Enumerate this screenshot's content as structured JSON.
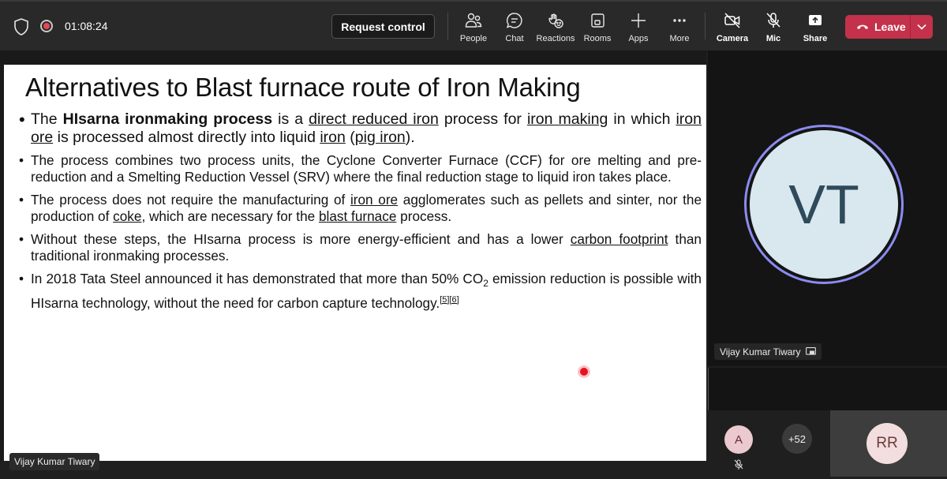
{
  "toolbar": {
    "timer": "01:08:24",
    "request_control": "Request control",
    "items": [
      {
        "label": "People",
        "icon": "people-icon"
      },
      {
        "label": "Chat",
        "icon": "chat-icon"
      },
      {
        "label": "Reactions",
        "icon": "reactions-icon"
      },
      {
        "label": "Rooms",
        "icon": "rooms-icon"
      },
      {
        "label": "Apps",
        "icon": "plus-icon"
      },
      {
        "label": "More",
        "icon": "more-icon"
      },
      {
        "label": "Camera",
        "icon": "camera-off-icon"
      },
      {
        "label": "Mic",
        "icon": "mic-off-icon"
      },
      {
        "label": "Share",
        "icon": "share-icon"
      }
    ],
    "leave": "Leave",
    "leave_color": "#c4314b"
  },
  "slide": {
    "title": "Alternatives to Blast furnace route of Iron Making",
    "b1": {
      "t1": "The ",
      "bold": "HIsarna ironmaking process",
      "t2": " is a ",
      "l1": "direct reduced iron",
      "t3": " process for ",
      "l2": "iron making",
      "t4": " in which ",
      "l3": "iron ore",
      "t5": " is processed almost directly into liquid ",
      "l4": "iron",
      "t6": " (",
      "l5": "pig iron",
      "t7": ")."
    },
    "b2": "The process combines two process units, the Cyclone Converter Furnace (CCF) for ore melting and pre-reduction and a Smelting Reduction Vessel (SRV) where the final reduction stage to liquid iron takes place.",
    "b3": {
      "t1": "The process does not require the manufacturing of ",
      "l1": "iron ore",
      "t2": " agglomerates such as pellets and sinter, nor the production of ",
      "l2": "coke",
      "t3": ", which are necessary for the ",
      "l3": "blast furnace",
      "t4": " process."
    },
    "b4": {
      "t1": "Without these steps, the HIsarna process is more energy-efficient and has a lower ",
      "l1": "carbon footprint",
      "t2": " than traditional ironmaking processes."
    },
    "b5": {
      "t1": "In 2018 Tata Steel announced it has demonstrated that more than 50% CO",
      "sub": "2",
      "t2": " emission reduction is possible with HIsarna technology, without the need for carbon capture technology.",
      "ref": "[5][6]"
    }
  },
  "presenter_name": "Vijay Kumar Tiwary",
  "participants": {
    "main_initials": "VT",
    "main_name": "Vijay Kumar Tiwary",
    "ring_color": "#8b8cf0",
    "small_initial": "A",
    "more_count": "+52",
    "rr_initials": "RR"
  }
}
